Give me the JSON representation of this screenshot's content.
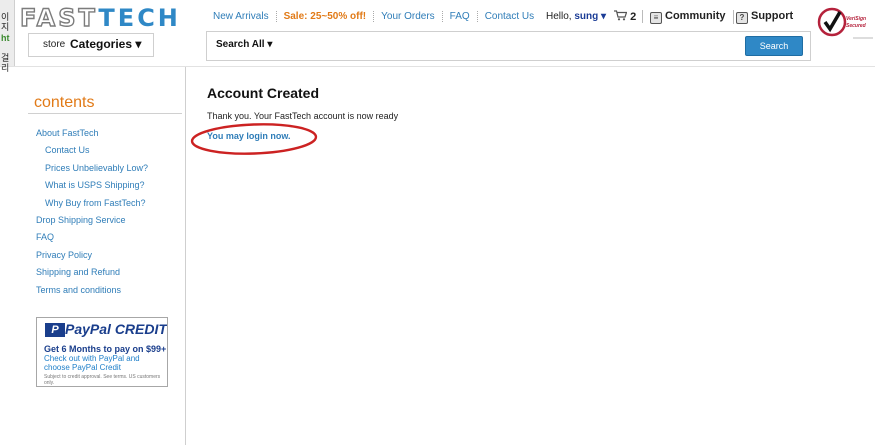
{
  "left_strip": [
    "이지",
    "ht",
    "걸리"
  ],
  "logo": {
    "part1": "FAST",
    "part2": "TECH"
  },
  "store": {
    "label": "store",
    "categories": "Categories ▾"
  },
  "topnav": [
    {
      "label": "New Arrivals"
    },
    {
      "label": "Sale: 25~50% off!"
    },
    {
      "label": "Your Orders"
    },
    {
      "label": "FAQ"
    },
    {
      "label": "Contact Us"
    }
  ],
  "user": {
    "hello": "Hello,",
    "name": "sung ▾"
  },
  "cart": {
    "count": "2"
  },
  "community": {
    "label": "Community"
  },
  "support": {
    "label": "Support"
  },
  "verisign": {
    "line1": "VeriSign",
    "line2": "Secured"
  },
  "search": {
    "scope": "Search All ▾",
    "button": "Search"
  },
  "sidebar": {
    "title": "contents",
    "links": [
      {
        "label": "About FastTech"
      },
      {
        "label": "Contact Us"
      },
      {
        "label": "Prices Unbelievably Low?"
      },
      {
        "label": "What is USPS Shipping?"
      },
      {
        "label": "Why Buy from FastTech?"
      },
      {
        "label": "Drop Shipping Service"
      },
      {
        "label": "FAQ"
      },
      {
        "label": "Privacy Policy"
      },
      {
        "label": "Shipping and Refund"
      },
      {
        "label": "Terms and conditions"
      }
    ]
  },
  "paypal": {
    "logo_letter": "P",
    "title": "PayPal CREDIT",
    "line1": "Get 6 Months to pay on $99+",
    "line2": "Check out with PayPal and choose PayPal Credit",
    "line3": "Subject to credit approval. See terms. US customers only."
  },
  "main": {
    "title": "Account Created",
    "message": "Thank you. Your FastTech account is now ready",
    "login_link": "You may login now."
  },
  "colors": {
    "accent": "#2f88c6",
    "orange": "#e17a17",
    "link": "#2f7db8",
    "annotation": "#cc2222"
  }
}
